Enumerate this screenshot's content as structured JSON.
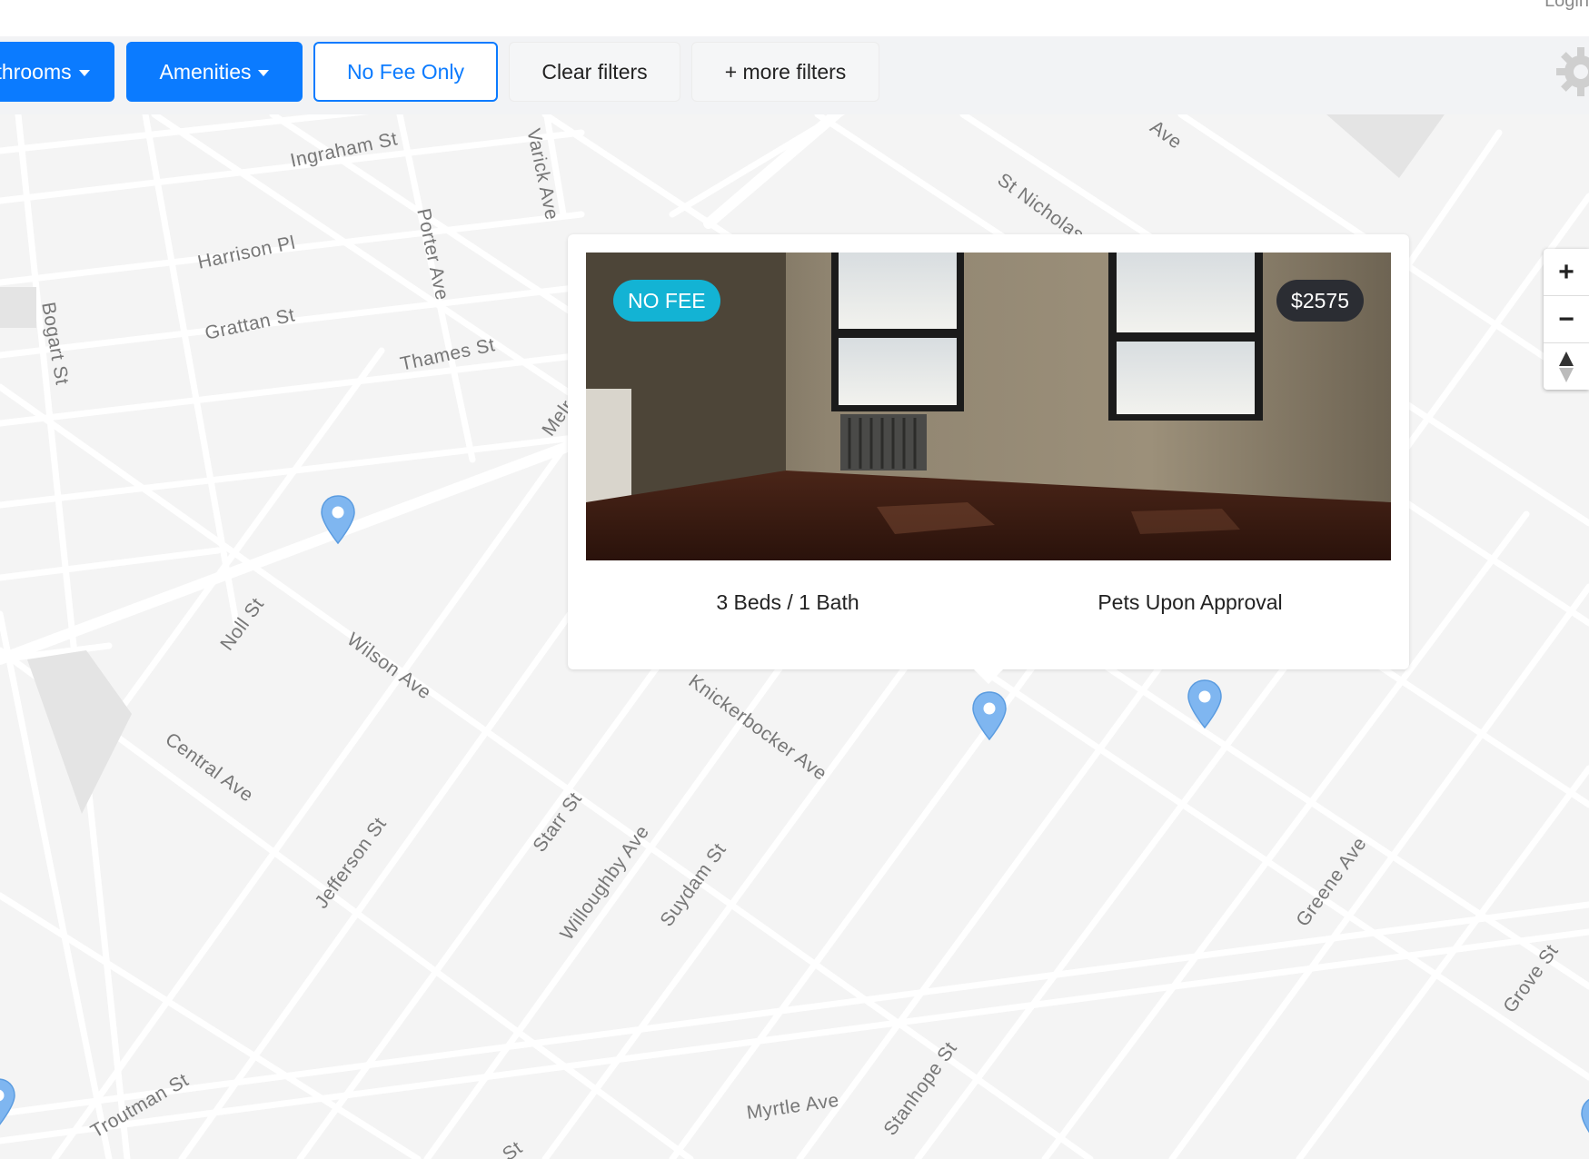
{
  "header": {
    "login_label": "Login"
  },
  "filters": {
    "bathrooms_label": "Bathrooms",
    "amenities_label": "Amenities",
    "no_fee_label": "No Fee Only",
    "clear_label": "Clear filters",
    "more_label": "+ more filters"
  },
  "map": {
    "zoom_in": "+",
    "zoom_out": "−",
    "streets": {
      "ingraham": "Ingraham St",
      "harrison": "Harrison Pl",
      "grattan": "Grattan St",
      "thames": "Thames St",
      "bogart": "Bogart St",
      "porter": "Porter Ave",
      "varick": "Varick Ave",
      "st_nicholas": "St Nicholas Ave",
      "ave_top": "Ave",
      "noll": "Noll St",
      "wilson": "Wilson Ave",
      "central": "Central Ave",
      "jefferson": "Jefferson St",
      "starr": "Starr St",
      "willoughby": "Willoughby Ave",
      "suydam": "Suydam St",
      "knickerbocker": "Knickerbocker Ave",
      "greene": "Greene Ave",
      "grove": "Grove St",
      "stanhope": "Stanhope St",
      "myrtle": "Myrtle Ave",
      "troutman": "Troutman St",
      "mel": "Melrose St",
      "bottom_st": "St"
    }
  },
  "listing": {
    "fee_badge": "NO FEE",
    "price": "$2575",
    "beds_baths": "3 Beds / 1 Bath",
    "pets": "Pets Upon Approval"
  },
  "colors": {
    "primary": "#0b7bff",
    "fee_badge": "#13b3d4",
    "price_badge": "#2b2d33",
    "pin": "#7fb6f0",
    "map_bg": "#f4f4f4"
  }
}
